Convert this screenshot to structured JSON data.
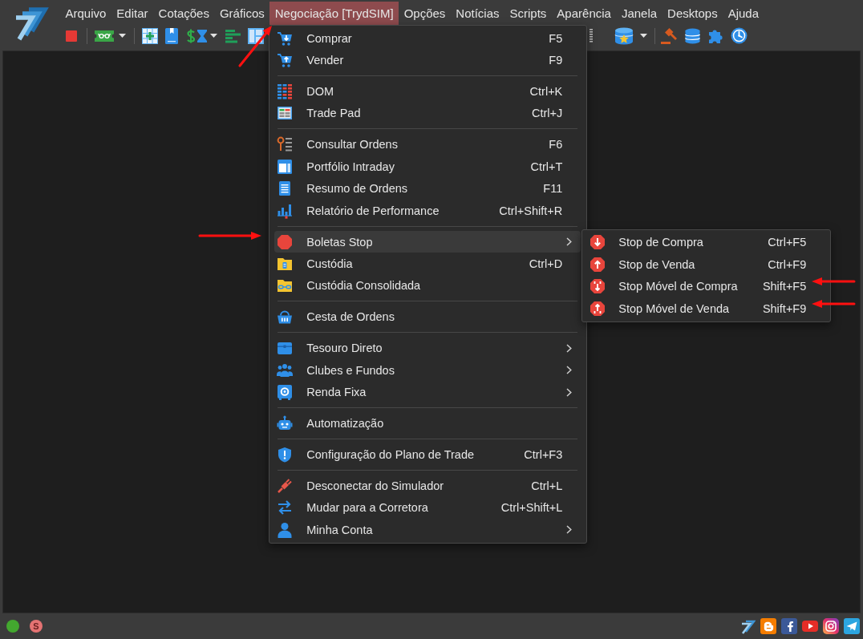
{
  "menubar": [
    {
      "label": "Arquivo",
      "selected": false,
      "annotation_arrow": false
    },
    {
      "label": "Editar",
      "selected": false,
      "annotation_arrow": false
    },
    {
      "label": "Cotações",
      "selected": false,
      "annotation_arrow": false
    },
    {
      "label": "Gráficos",
      "selected": false,
      "annotation_arrow": false
    },
    {
      "label": "Negociação [TrydSIM]",
      "selected": true,
      "annotation_arrow": true,
      "menu": [
        {
          "items": [
            {
              "label": "Comprar",
              "shortcut": "F5",
              "selected": false,
              "submenu": false,
              "annotation_arrow": false
            },
            {
              "label": "Vender",
              "shortcut": "F9",
              "selected": false,
              "submenu": false,
              "annotation_arrow": false
            }
          ]
        },
        {
          "items": [
            {
              "label": "DOM",
              "shortcut": "Ctrl+K",
              "selected": false,
              "submenu": false,
              "annotation_arrow": false
            },
            {
              "label": "Trade Pad",
              "shortcut": "Ctrl+J",
              "selected": false,
              "submenu": false,
              "annotation_arrow": false
            }
          ]
        },
        {
          "items": [
            {
              "label": "Consultar Ordens",
              "shortcut": "F6",
              "selected": false,
              "submenu": false,
              "annotation_arrow": false
            },
            {
              "label": "Portfólio Intraday",
              "shortcut": "Ctrl+T",
              "selected": false,
              "submenu": false,
              "annotation_arrow": false
            },
            {
              "label": "Resumo de Ordens",
              "shortcut": "F11",
              "selected": false,
              "submenu": false,
              "annotation_arrow": false
            },
            {
              "label": "Relatório de Performance",
              "shortcut": "Ctrl+Shift+R",
              "selected": false,
              "submenu": false,
              "annotation_arrow": false
            }
          ]
        },
        {
          "items": [
            {
              "label": "Boletas Stop",
              "selected": true,
              "submenu": true,
              "annotation_arrow": true,
              "open_submenu": [
                {
                  "label": "Stop de Compra",
                  "shortcut": "Ctrl+F5",
                  "selected": false,
                  "annotation_arrow": false
                },
                {
                  "label": "Stop de Venda",
                  "shortcut": "Ctrl+F9",
                  "selected": false,
                  "annotation_arrow": false
                },
                {
                  "label": "Stop Móvel de Compra",
                  "shortcut": "Shift+F5",
                  "selected": false,
                  "annotation_arrow": true
                },
                {
                  "label": "Stop Móvel de Venda",
                  "shortcut": "Shift+F9",
                  "selected": false,
                  "annotation_arrow": true
                }
              ]
            },
            {
              "label": "Custódia",
              "shortcut": "Ctrl+D",
              "selected": false,
              "submenu": false,
              "annotation_arrow": false
            },
            {
              "label": "Custódia Consolidada",
              "selected": false,
              "submenu": false,
              "annotation_arrow": false
            }
          ]
        },
        {
          "items": [
            {
              "label": "Cesta de Ordens",
              "selected": false,
              "submenu": false,
              "annotation_arrow": false
            }
          ]
        },
        {
          "items": [
            {
              "label": "Tesouro Direto",
              "selected": false,
              "submenu": true,
              "annotation_arrow": false
            },
            {
              "label": "Clubes e Fundos",
              "selected": false,
              "submenu": true,
              "annotation_arrow": false
            },
            {
              "label": "Renda Fixa",
              "selected": false,
              "submenu": true,
              "annotation_arrow": false
            }
          ]
        },
        {
          "items": [
            {
              "label": "Automatização",
              "selected": false,
              "submenu": false,
              "annotation_arrow": false
            }
          ]
        },
        {
          "items": [
            {
              "label": "Configuração do Plano de Trade",
              "shortcut": "Ctrl+F3",
              "selected": false,
              "submenu": false,
              "annotation_arrow": false
            }
          ]
        },
        {
          "items": [
            {
              "label": "Desconectar do Simulador",
              "shortcut": "Ctrl+L",
              "selected": false,
              "submenu": false,
              "annotation_arrow": false
            },
            {
              "label": "Mudar para a Corretora",
              "shortcut": "Ctrl+Shift+L",
              "selected": false,
              "submenu": false,
              "annotation_arrow": false
            },
            {
              "label": "Minha Conta",
              "selected": false,
              "submenu": true,
              "annotation_arrow": false
            }
          ]
        }
      ]
    },
    {
      "label": "Opções",
      "selected": false,
      "annotation_arrow": false
    },
    {
      "label": "Notícias",
      "selected": false,
      "annotation_arrow": false
    },
    {
      "label": "Scripts",
      "selected": false,
      "annotation_arrow": false
    },
    {
      "label": "Aparência",
      "selected": false,
      "annotation_arrow": false
    },
    {
      "label": "Janela",
      "selected": false,
      "annotation_arrow": false
    },
    {
      "label": "Desktops",
      "selected": false,
      "annotation_arrow": false
    },
    {
      "label": "Ajuda",
      "selected": false,
      "annotation_arrow": false
    }
  ],
  "status_bar": {
    "connected": true,
    "mode_badge": "S"
  }
}
